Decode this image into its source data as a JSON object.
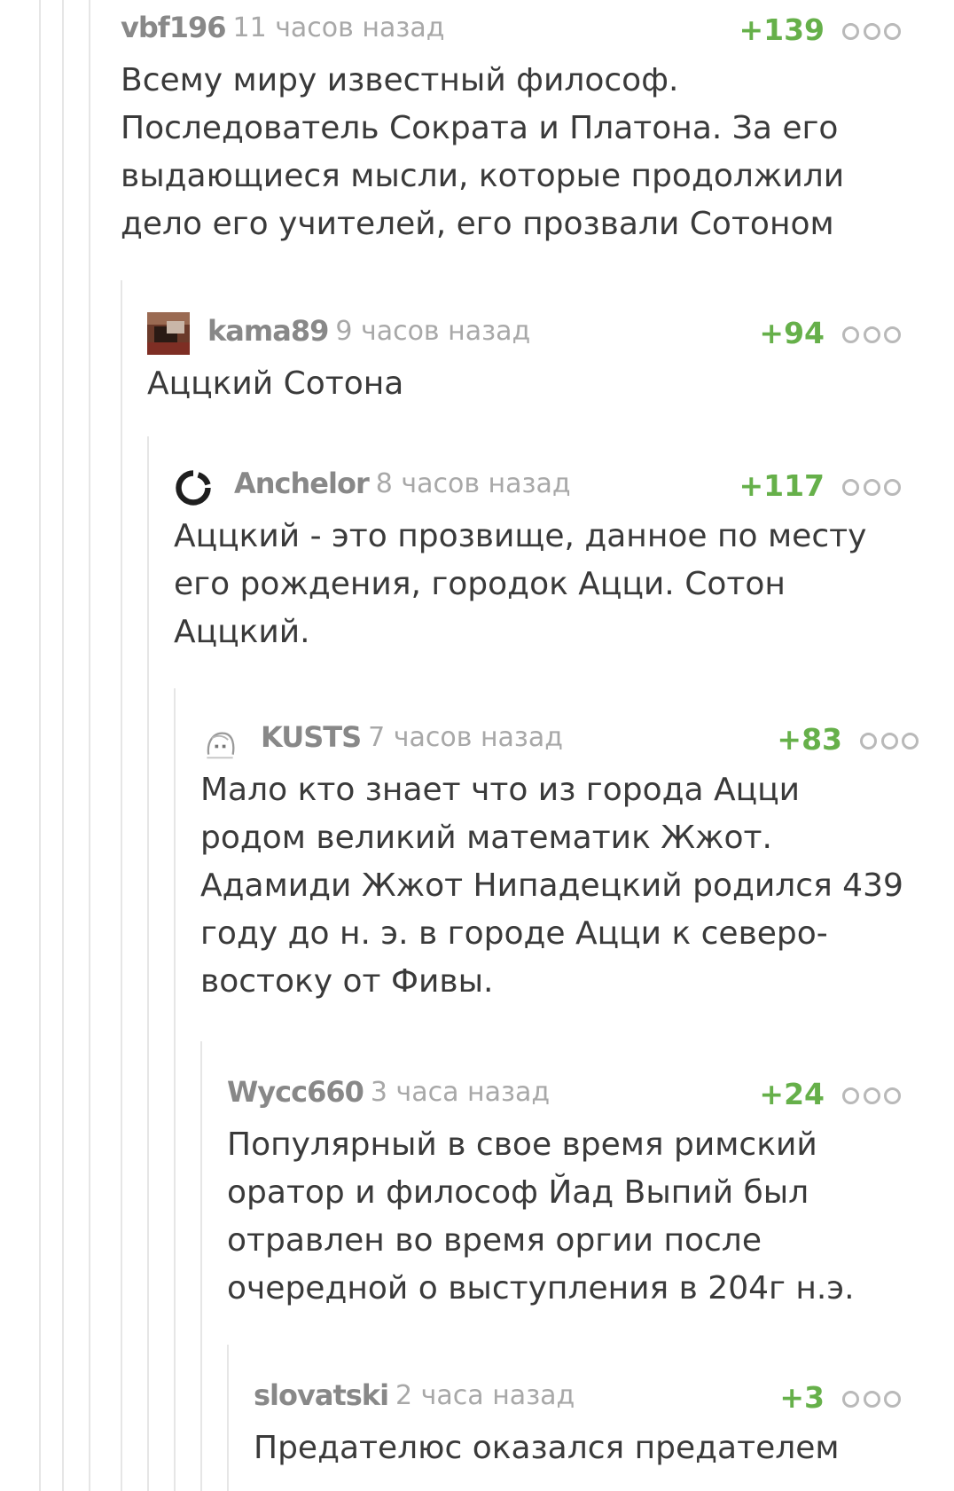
{
  "comments": [
    {
      "author": "vbf196",
      "time": "11 часов назад",
      "rating": "+139",
      "text": "Всему миру известный философ.\nПоследователь Сократа и Платона. За его\nвыдающиеся мысли, которые продолжили\nдело его учителей, его прозвали Сотоном",
      "avatar": "none"
    },
    {
      "author": "kama89",
      "time": "9 часов назад",
      "rating": "+94",
      "text": "Аццкий Сотона",
      "avatar": "photo"
    },
    {
      "author": "Anchelor",
      "time": "8 часов назад",
      "rating": "+117",
      "text": "Аццкий - это прозвище, данное по месту\nего рождения, городок Ацци. Сотон\nАццкий.",
      "avatar": "ring-icon"
    },
    {
      "author": "KUSTS",
      "time": "7 часов назад",
      "rating": "+83",
      "text": "Мало кто знает что из города Ацци\nродом великий математик Жжот.\nАдамиди Жжот Нипадецкий родился 439\nгоду  до н. э. в городе Ацци к северо-\nвостоку от Фивы.",
      "avatar": "sketch"
    },
    {
      "author": "Wycc660",
      "time": "3 часа назад",
      "rating": "+24",
      "text": "Популярный в свое время римский\nоратор и философ Йад Выпий был\nотравлен во время оргии после\nочередной о выступления в 204г н.э.",
      "avatar": "none"
    },
    {
      "author": "slovatski",
      "time": "2 часа назад",
      "rating": "+3",
      "text": "Предателюс оказался предателем",
      "avatar": "none"
    }
  ],
  "colors": {
    "rating": "#66b04a",
    "author": "#888888",
    "time": "#a8a8a8",
    "text": "#3a3a3a",
    "thread_line": "#e6e6e6"
  },
  "icons": {
    "more": "three-dots-icon"
  }
}
